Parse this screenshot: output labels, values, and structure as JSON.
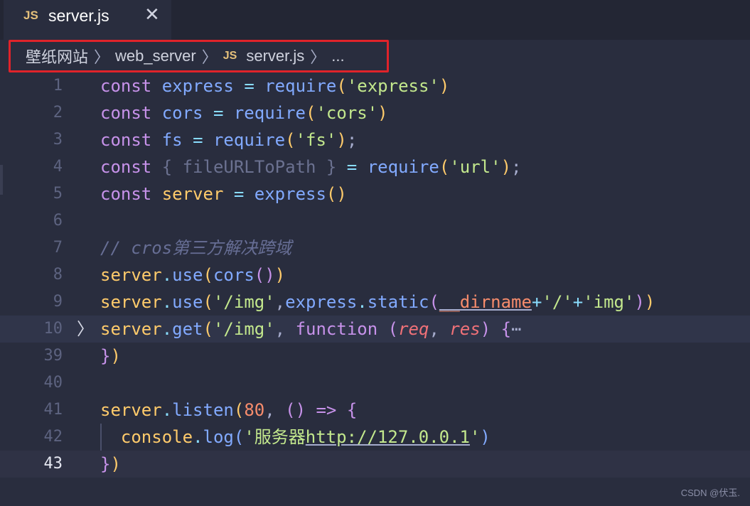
{
  "tab": {
    "badge": "JS",
    "filename": "server.js",
    "close": "✕"
  },
  "breadcrumb": {
    "items": [
      "壁纸网站",
      "web_server",
      "server.js",
      "..."
    ],
    "sep": "〉",
    "badge": "JS"
  },
  "editor": {
    "lines": [
      {
        "n": "1",
        "text": "const express = require('express')"
      },
      {
        "n": "2",
        "text": "const cors = require('cors')"
      },
      {
        "n": "3",
        "text": "const fs = require('fs');"
      },
      {
        "n": "4",
        "text": "const { fileURLToPath } = require('url');"
      },
      {
        "n": "5",
        "text": "const server = express()"
      },
      {
        "n": "6",
        "text": ""
      },
      {
        "n": "7",
        "text": "// cros第三方解决跨域"
      },
      {
        "n": "8",
        "text": "server.use(cors())"
      },
      {
        "n": "9",
        "text": "server.use('/img',express.static(__dirname+'/'+'img'))"
      },
      {
        "n": "10",
        "text": "server.get('/img', function (req, res) {⋯"
      },
      {
        "n": "39",
        "text": "})"
      },
      {
        "n": "40",
        "text": ""
      },
      {
        "n": "41",
        "text": "server.listen(80, () => {"
      },
      {
        "n": "42",
        "text": "  console.log('服务器http://127.0.0.1')"
      },
      {
        "n": "43",
        "text": "})"
      }
    ],
    "fold_icon": "〉"
  },
  "watermark": "CSDN @伏玉."
}
